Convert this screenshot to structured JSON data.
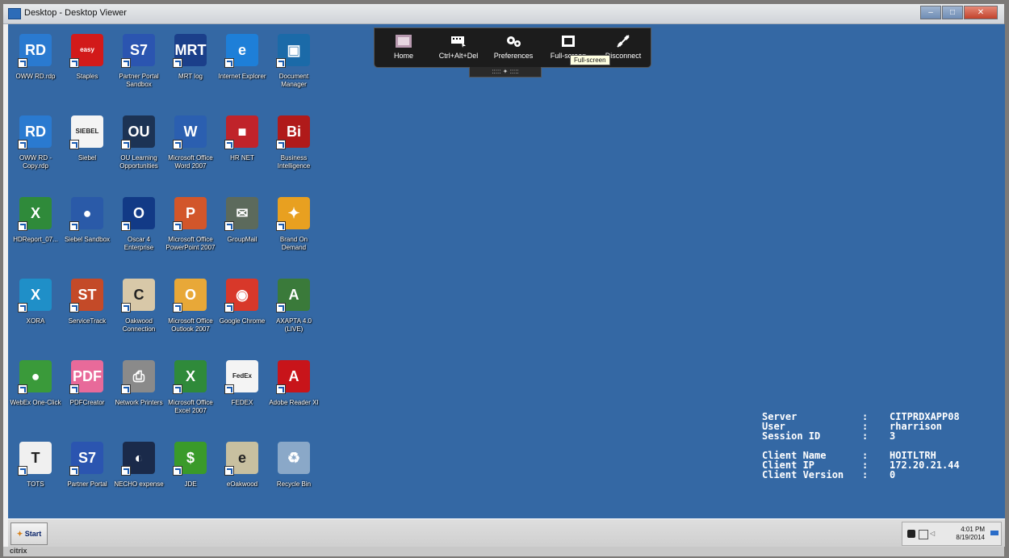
{
  "window": {
    "title": "Desktop - Desktop Viewer"
  },
  "toolbar": {
    "buttons": [
      {
        "label": "Home",
        "icon": "home-thumbnail-icon"
      },
      {
        "label": "Ctrl+Alt+Del",
        "icon": "keyboard-icon"
      },
      {
        "label": "Preferences",
        "icon": "gears-icon"
      },
      {
        "label": "Full-screen",
        "icon": "fullscreen-icon"
      },
      {
        "label": "Disconnect",
        "icon": "plug-icon"
      }
    ],
    "tooltip": "Full-screen",
    "handle": "::::: ✦ :::::"
  },
  "desktop_icons": [
    {
      "label": "OWW RD.rdp",
      "icon": "remote-desktop-icon",
      "color": "#2a7ad0",
      "glyph": "RD"
    },
    {
      "label": "Staples",
      "icon": "easy-button-icon",
      "color": "#d21a1a",
      "glyph": "easy"
    },
    {
      "label": "Partner Portal Sandbox",
      "icon": "siebel-globe-icon",
      "color": "#2b55b0",
      "glyph": "S7"
    },
    {
      "label": "MRT log",
      "icon": "mrt-log-icon",
      "color": "#1b3f8a",
      "glyph": "MRT"
    },
    {
      "label": "Internet Explorer",
      "icon": "internet-explorer-icon",
      "color": "#1e7fd8",
      "glyph": "e"
    },
    {
      "label": "Document Manager",
      "icon": "document-manager-icon",
      "color": "#1b6aa8",
      "glyph": "▣"
    },
    {
      "label": "OWW RD - Copy.rdp",
      "icon": "remote-desktop-icon",
      "color": "#2a7ad0",
      "glyph": "RD"
    },
    {
      "label": "Siebel",
      "icon": "siebel-icon",
      "color": "#f4f4f4",
      "glyph": "SIEBEL"
    },
    {
      "label": "OU Learning Opportunities",
      "icon": "learning-icon",
      "color": "#1c3354",
      "glyph": "OU"
    },
    {
      "label": "Microsoft Office Word 2007",
      "icon": "word-icon",
      "color": "#2b5fb0",
      "glyph": "W"
    },
    {
      "label": "HR NET",
      "icon": "gift-box-icon",
      "color": "#c0232a",
      "glyph": "■"
    },
    {
      "label": "Business Intelligence",
      "icon": "business-intelligence-icon",
      "color": "#b01a1a",
      "glyph": "Bi"
    },
    {
      "label": "HDReport_07...",
      "icon": "excel-chart-icon",
      "color": "#2f8a3a",
      "glyph": "X"
    },
    {
      "label": "Siebel Sandbox",
      "icon": "siebel-sandbox-icon",
      "color": "#2a5aa8",
      "glyph": "●"
    },
    {
      "label": "Oscar 4 Enterprise",
      "icon": "oscar-icon",
      "color": "#123a86",
      "glyph": "O"
    },
    {
      "label": "Microsoft Office PowerPoint 2007",
      "icon": "powerpoint-icon",
      "color": "#d2562a",
      "glyph": "P"
    },
    {
      "label": "GroupMail",
      "icon": "groupmail-icon",
      "color": "#5c6a5c",
      "glyph": "✉"
    },
    {
      "label": "Brand On Demand",
      "icon": "brand-on-demand-icon",
      "color": "#e8a020",
      "glyph": "✦"
    },
    {
      "label": "XORA",
      "icon": "xora-icon",
      "color": "#1f8fc8",
      "glyph": "X"
    },
    {
      "label": "ServiceTrack",
      "icon": "servicetrack-icon",
      "color": "#c44a28",
      "glyph": "ST"
    },
    {
      "label": "Oakwood Connection",
      "icon": "oakwood-icon",
      "color": "#d8c8a8",
      "glyph": "C"
    },
    {
      "label": "Microsoft Office Outlook 2007",
      "icon": "outlook-icon",
      "color": "#e8a838",
      "glyph": "O"
    },
    {
      "label": "Google Chrome",
      "icon": "chrome-icon",
      "color": "#d8382a",
      "glyph": "◉"
    },
    {
      "label": "AXAPTA 4.0 (LIVE)",
      "icon": "axapta-icon",
      "color": "#3a7a3a",
      "glyph": "A"
    },
    {
      "label": "WebEx One-Click",
      "icon": "webex-icon",
      "color": "#3a9a3a",
      "glyph": "●"
    },
    {
      "label": "PDFCreator",
      "icon": "pdfcreator-icon",
      "color": "#e86a9a",
      "glyph": "PDF"
    },
    {
      "label": "Network Printers",
      "icon": "printer-icon",
      "color": "#8a8a8a",
      "glyph": "⎙"
    },
    {
      "label": "Microsoft Office Excel 2007",
      "icon": "excel-icon",
      "color": "#2f8a3a",
      "glyph": "X"
    },
    {
      "label": "FEDEX",
      "icon": "fedex-icon",
      "color": "#f4f4f4",
      "glyph": "FedEx"
    },
    {
      "label": "Adobe Reader XI",
      "icon": "adobe-reader-icon",
      "color": "#c8141a",
      "glyph": "A"
    },
    {
      "label": "TOTS",
      "icon": "tots-icon",
      "color": "#f0f0f0",
      "glyph": "T"
    },
    {
      "label": "Partner Portal",
      "icon": "siebel-globe-icon",
      "color": "#2b55b0",
      "glyph": "S7"
    },
    {
      "label": "NECHO expense",
      "icon": "necho-icon",
      "color": "#1a2a4a",
      "glyph": "◐"
    },
    {
      "label": "JDE",
      "icon": "dollar-icon",
      "color": "#3a9a2a",
      "glyph": "$"
    },
    {
      "label": "eOakwood",
      "icon": "eoakwood-icon",
      "color": "#c8c0a0",
      "glyph": "e"
    },
    {
      "label": "Recycle Bin",
      "icon": "recycle-bin-icon",
      "color": "#8aa8c8",
      "glyph": "♻"
    }
  ],
  "session_info": {
    "rows": [
      {
        "key": "Server",
        "value": "CITPRDXAPP08"
      },
      {
        "key": "User",
        "value": "rharrison"
      },
      {
        "key": "Session ID",
        "value": "3"
      },
      {
        "key": "",
        "value": ""
      },
      {
        "key": "Client Name",
        "value": "HOITLTRH"
      },
      {
        "key": "Client IP",
        "value": "172.20.21.44"
      },
      {
        "key": "Client Version",
        "value": "0"
      }
    ],
    "separator": ":"
  },
  "taskbar": {
    "start_label": "Start",
    "clock_time": "4:01 PM",
    "clock_date": "8/19/2014"
  },
  "footer": {
    "brand": "citrix"
  }
}
